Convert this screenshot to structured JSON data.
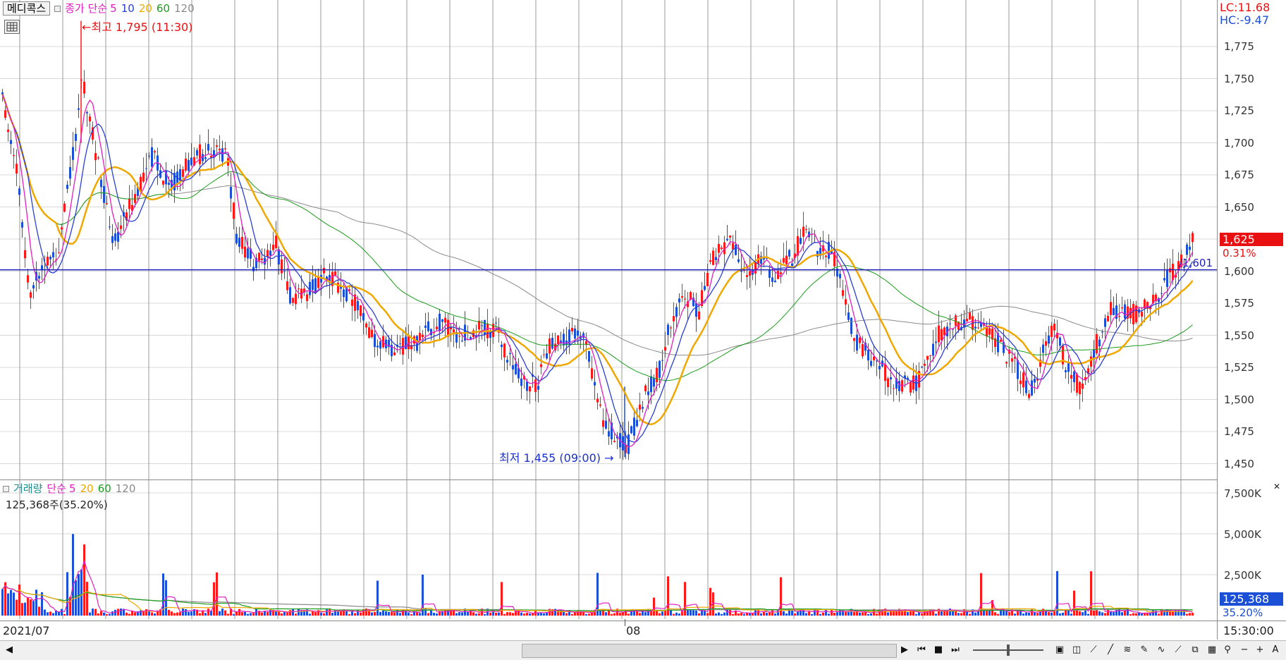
{
  "header": {
    "stock_name": "메디콕스",
    "price_legend": {
      "label": "종가 단순",
      "p5": "5",
      "p10": "10",
      "p20": "20",
      "p60": "60",
      "p120": "120"
    },
    "lc": "LC:11.68",
    "hc": "HC:-9.47"
  },
  "annotations": {
    "high": "최고 1,795 (11:30)",
    "low": "최저 1,455 (09:00)",
    "ref_line": "1,601"
  },
  "price_axis": {
    "ticks": [
      "1,775",
      "1,750",
      "1,725",
      "1,700",
      "1,675",
      "1,650",
      "1,625",
      "1,600",
      "1,575",
      "1,550",
      "1,525",
      "1,500",
      "1,475",
      "1,450"
    ],
    "current_price": "1,625",
    "current_change": "0.31%"
  },
  "volume": {
    "legend": {
      "label": "거래량",
      "ma_label": "단순",
      "p5": "5",
      "p20": "20",
      "p60": "60",
      "p120": "120"
    },
    "info": "125,368주(35.20%)",
    "ticks": [
      "7,500K",
      "5,000K",
      "2,500K"
    ],
    "current": "125,368",
    "current_pct": "35.20%"
  },
  "date_axis": {
    "left": "2021/07",
    "mid": "08"
  },
  "time": "15:30:00",
  "colors": {
    "up": "#ff1a1a",
    "down": "#1a4fd6",
    "ma5": "#e020c0",
    "ma10": "#2a3fd0",
    "ma20": "#f0a800",
    "ma60": "#1a9c1a",
    "ma120": "#8a8a8a",
    "ref_line": "#2020b8",
    "badge_price": "#e81010",
    "badge_volume": "#1a4fd6"
  },
  "chart_data": {
    "type": "candlestick",
    "price_range": [
      1440,
      1790
    ],
    "high_point": {
      "value": 1795,
      "time": "11:30"
    },
    "low_point": {
      "value": 1455,
      "time": "09:00"
    },
    "reference_level": 1601,
    "last_close": 1625,
    "change_pct": 0.31,
    "volume_max": 8000,
    "volume_unit": "K",
    "last_volume": 125368,
    "overlays": [
      "MA5",
      "MA10",
      "MA20",
      "MA60",
      "MA120"
    ]
  },
  "toolbar": {
    "icons": [
      "play-icon",
      "rewind-icon",
      "stop-icon",
      "fast-forward-icon",
      "zoom-slider",
      "layout-icon",
      "split-icon",
      "trend-icon",
      "line-tool-icon",
      "fib-icon",
      "pen-icon",
      "magnify-icon",
      "zoom-out-icon",
      "zoom-in-icon",
      "text-tool-icon"
    ]
  }
}
